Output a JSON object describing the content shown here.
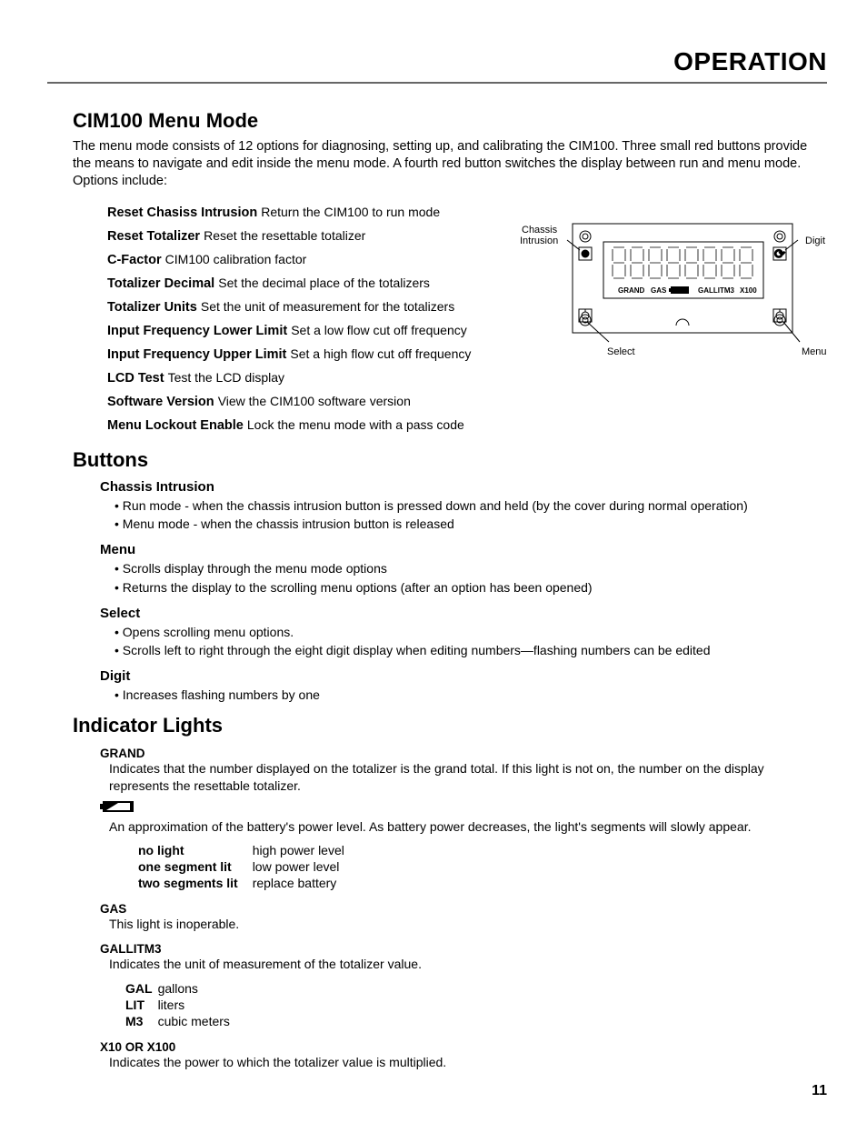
{
  "header": "OPERATION",
  "page_number": "11",
  "s1": {
    "title": "CIM100 Menu Mode",
    "intro": "The menu mode consists of 12 options for diagnosing, setting up, and calibrating the CIM100. Three small red buttons provide the means to navigate and edit inside the menu mode. A fourth red button switches the display between run and menu mode. Options include:",
    "items": [
      {
        "name": "Reset Chasiss Intrusion",
        "desc": "Return the CIM100 to run mode"
      },
      {
        "name": "Reset Totalizer",
        "desc": "Reset the resettable totalizer"
      },
      {
        "name": "C-Factor",
        "desc": "CIM100 calibration factor"
      },
      {
        "name": "Totalizer Decimal",
        "desc": "Set the decimal place of the totalizers"
      },
      {
        "name": "Totalizer Units",
        "desc": "Set the unit of measurement for the totalizers"
      },
      {
        "name": "Input Frequency Lower Limit",
        "desc": "Set a low flow cut off frequency"
      },
      {
        "name": "Input Frequency Upper Limit",
        "desc": "Set a high flow cut off frequency"
      },
      {
        "name": "LCD Test",
        "desc": "Test the LCD display"
      },
      {
        "name": "Software Version",
        "desc": "View the CIM100 software version"
      },
      {
        "name": "Menu Lockout Enable",
        "desc": "Lock the menu mode with a pass code"
      }
    ]
  },
  "s2": {
    "title": "Buttons",
    "groups": [
      {
        "name": "Chassis Intrusion",
        "bullets": [
          "Run mode - when the chassis intrusion button is pressed down and held (by the cover during normal operation)",
          "Menu mode - when the chassis intrusion button is released"
        ]
      },
      {
        "name": "Menu",
        "bullets": [
          "Scrolls display through the menu mode options",
          "Returns the display to the scrolling menu options (after an option has been opened)"
        ]
      },
      {
        "name": "Select",
        "bullets": [
          "Opens scrolling menu options.",
          "Scrolls left to right through the eight digit display when editing numbers—flashing numbers can be edited"
        ]
      },
      {
        "name": "Digit",
        "bullets": [
          "Increases flashing numbers by one"
        ]
      }
    ]
  },
  "s3": {
    "title": "Indicator Lights",
    "grand": {
      "label": "GRAND",
      "text": "Indicates that the number displayed on the totalizer is the grand total. If this light is not on, the number on the display represents the resettable totalizer."
    },
    "battery": {
      "text": "An approximation of the battery's power level. As battery power decreases, the light's segments will slowly appear.",
      "rows": [
        [
          "no light",
          "high power level"
        ],
        [
          "one segment lit",
          "low power level"
        ],
        [
          "two segments lit",
          "replace battery"
        ]
      ]
    },
    "gas": {
      "label": "GAS",
      "text": "This light is inoperable."
    },
    "units": {
      "label": "GALLITM3",
      "text": "Indicates the unit of measurement of the totalizer value.",
      "rows": [
        [
          "GAL",
          "gallons"
        ],
        [
          "LIT",
          "liters"
        ],
        [
          "M3",
          "cubic meters"
        ]
      ]
    },
    "mult": {
      "label": "X10 OR X100",
      "text": "Indicates the power to which the totalizer value is multiplied."
    }
  },
  "figure": {
    "chassis_intrusion": "Chassis\nIntrusion",
    "digit": "Digit",
    "select": "Select",
    "menu": "Menu",
    "lcd_legend": [
      "GRAND",
      "GAS",
      "GALLITM3",
      "X100"
    ]
  }
}
